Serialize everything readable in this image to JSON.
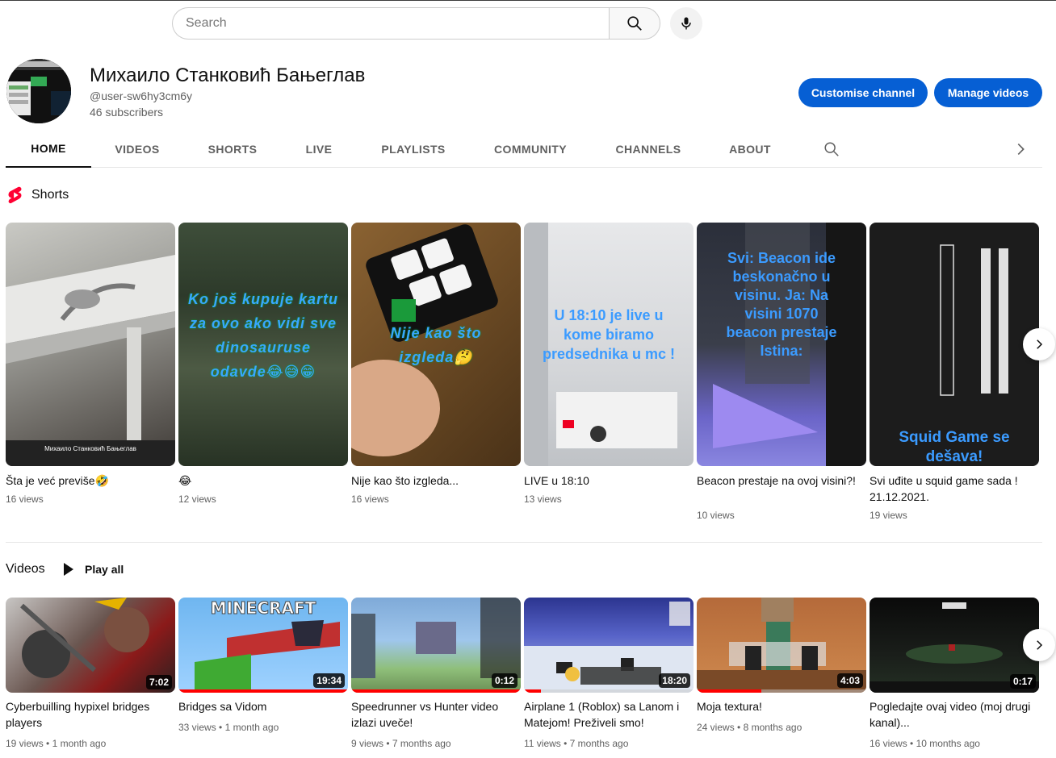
{
  "search": {
    "placeholder": "Search"
  },
  "channel": {
    "name": "Михаило Станковић Бањеглав",
    "handle": "@user-sw6hy3cm6y",
    "subscribers": "46 subscribers",
    "customise_label": "Customise channel",
    "manage_label": "Manage videos"
  },
  "tabs": [
    "HOME",
    "VIDEOS",
    "SHORTS",
    "LIVE",
    "PLAYLISTS",
    "COMMUNITY",
    "CHANNELS",
    "ABOUT"
  ],
  "shorts": {
    "title": "Shorts",
    "items": [
      {
        "title": "Šta je već previše🤣",
        "views": "16 views",
        "overlay": ""
      },
      {
        "title": "😂",
        "views": "12 views",
        "overlay": "Ko još kupuje kartu za ovo ako vidi sve dinosauruse odavde😂😅😁"
      },
      {
        "title": "Nije kao što izgleda...",
        "views": "16 views",
        "overlay": "Nije kao što izgleda🤔"
      },
      {
        "title": "LIVE u 18:10",
        "views": "13 views",
        "overlay": "U 18:10 je live u kome biramo predsednika u mc !"
      },
      {
        "title": "Beacon prestaje na ovoj visini?!",
        "views": "10 views",
        "overlay": "Svi: Beacon ide beskonačno u visinu. Ja: Na visini 1070 beacon prestaje Istina:"
      },
      {
        "title": "Svi uđite u squid game sada ! 21.12.2021.",
        "views": "19 views",
        "overlay": "Squid Game se dešava!"
      }
    ]
  },
  "videos": {
    "title": "Videos",
    "play_all": "Play all",
    "items": [
      {
        "title": "Cyberbuilling hypixel bridges players",
        "views": "19 views",
        "age": "1 month ago",
        "duration": "7:02",
        "progress": 0
      },
      {
        "title": "Bridges sa Vidom",
        "views": "33 views",
        "age": "1 month ago",
        "duration": "19:34",
        "progress": 1.0
      },
      {
        "title": "Speedrunner vs Hunter video izlazi uveče!",
        "views": "9 views",
        "age": "7 months ago",
        "duration": "0:12",
        "progress": 1.0
      },
      {
        "title": "Airplane 1 (Roblox) sa Lanom i Matejom! Preživeli smo!",
        "views": "11 views",
        "age": "7 months ago",
        "duration": "18:20",
        "progress": 0.1
      },
      {
        "title": "Moja textura!",
        "views": "24 views",
        "age": "8 months ago",
        "duration": "4:03",
        "progress": 0.38
      },
      {
        "title": "Pogledajte ovaj video (moj drugi kanal)...",
        "views": "16 views",
        "age": "10 months ago",
        "duration": "0:17",
        "progress": 0
      }
    ]
  },
  "colors": {
    "accent": "#065fd4",
    "progress": "#ff0000",
    "shorts_red": "#ff0033"
  }
}
